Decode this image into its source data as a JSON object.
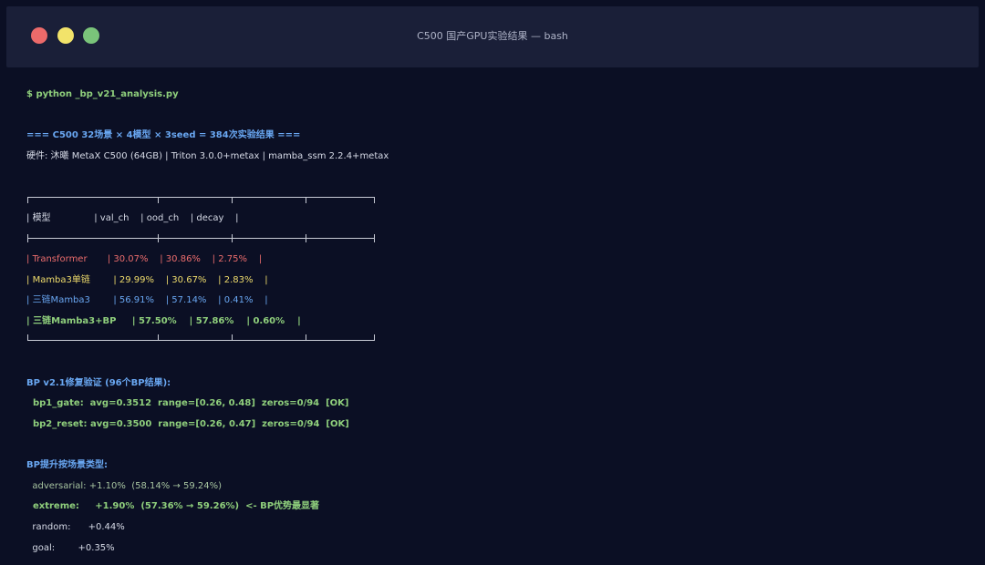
{
  "window": {
    "title": "C500 国产GPU实验结果 — bash",
    "colors": {
      "red": "#ec6a6a",
      "yellow": "#f2e36a",
      "green": "#7ac47a"
    }
  },
  "prompt": "$ python _bp_v21_analysis.py",
  "heading": "=== C500 32场景 × 4模型 × 3seed = 384次实验结果 ===",
  "hardware": "硬件: 沐曦 MetaX C500 (64GB) | Triton 3.0.0+metax | mamba_ssm 2.2.4+metax",
  "table": {
    "headers": [
      "模型",
      "val_ch",
      "ood_ch",
      "decay"
    ],
    "rows": [
      {
        "cells": [
          "Transformer",
          "30.07%",
          "30.86%",
          "2.75%"
        ],
        "color": "#ec6d6d"
      },
      {
        "cells": [
          "Mamba3单链",
          "29.99%",
          "30.67%",
          "2.83%"
        ],
        "color": "#f0dd6c"
      },
      {
        "cells": [
          "三链Mamba3",
          "56.91%",
          "57.14%",
          "0.41%"
        ],
        "color": "#69a7f2"
      },
      {
        "cells": [
          "三链Mamba3+BP",
          "57.50%",
          "57.86%",
          "0.60%"
        ],
        "color": "#8fcf7c"
      }
    ]
  },
  "bp_section": {
    "title": "BP v2.1修复验证 (96个BP结果):",
    "lines": [
      "  bp1_gate:  avg=0.3512  range=[0.26, 0.48]  zeros=0/94  [OK]",
      "  bp2_reset: avg=0.3500  range=[0.26, 0.47]  zeros=0/94  [OK]"
    ]
  },
  "scene_section": {
    "title": "BP提升按场景类型:",
    "lines": [
      "  adversarial: +1.10%  (58.14% → 59.24%)",
      "  extreme:     +1.90%  (57.36% → 59.26%)  <- BP优势最显著",
      "  random:      +0.44%",
      "  goal:        +0.35%"
    ]
  }
}
